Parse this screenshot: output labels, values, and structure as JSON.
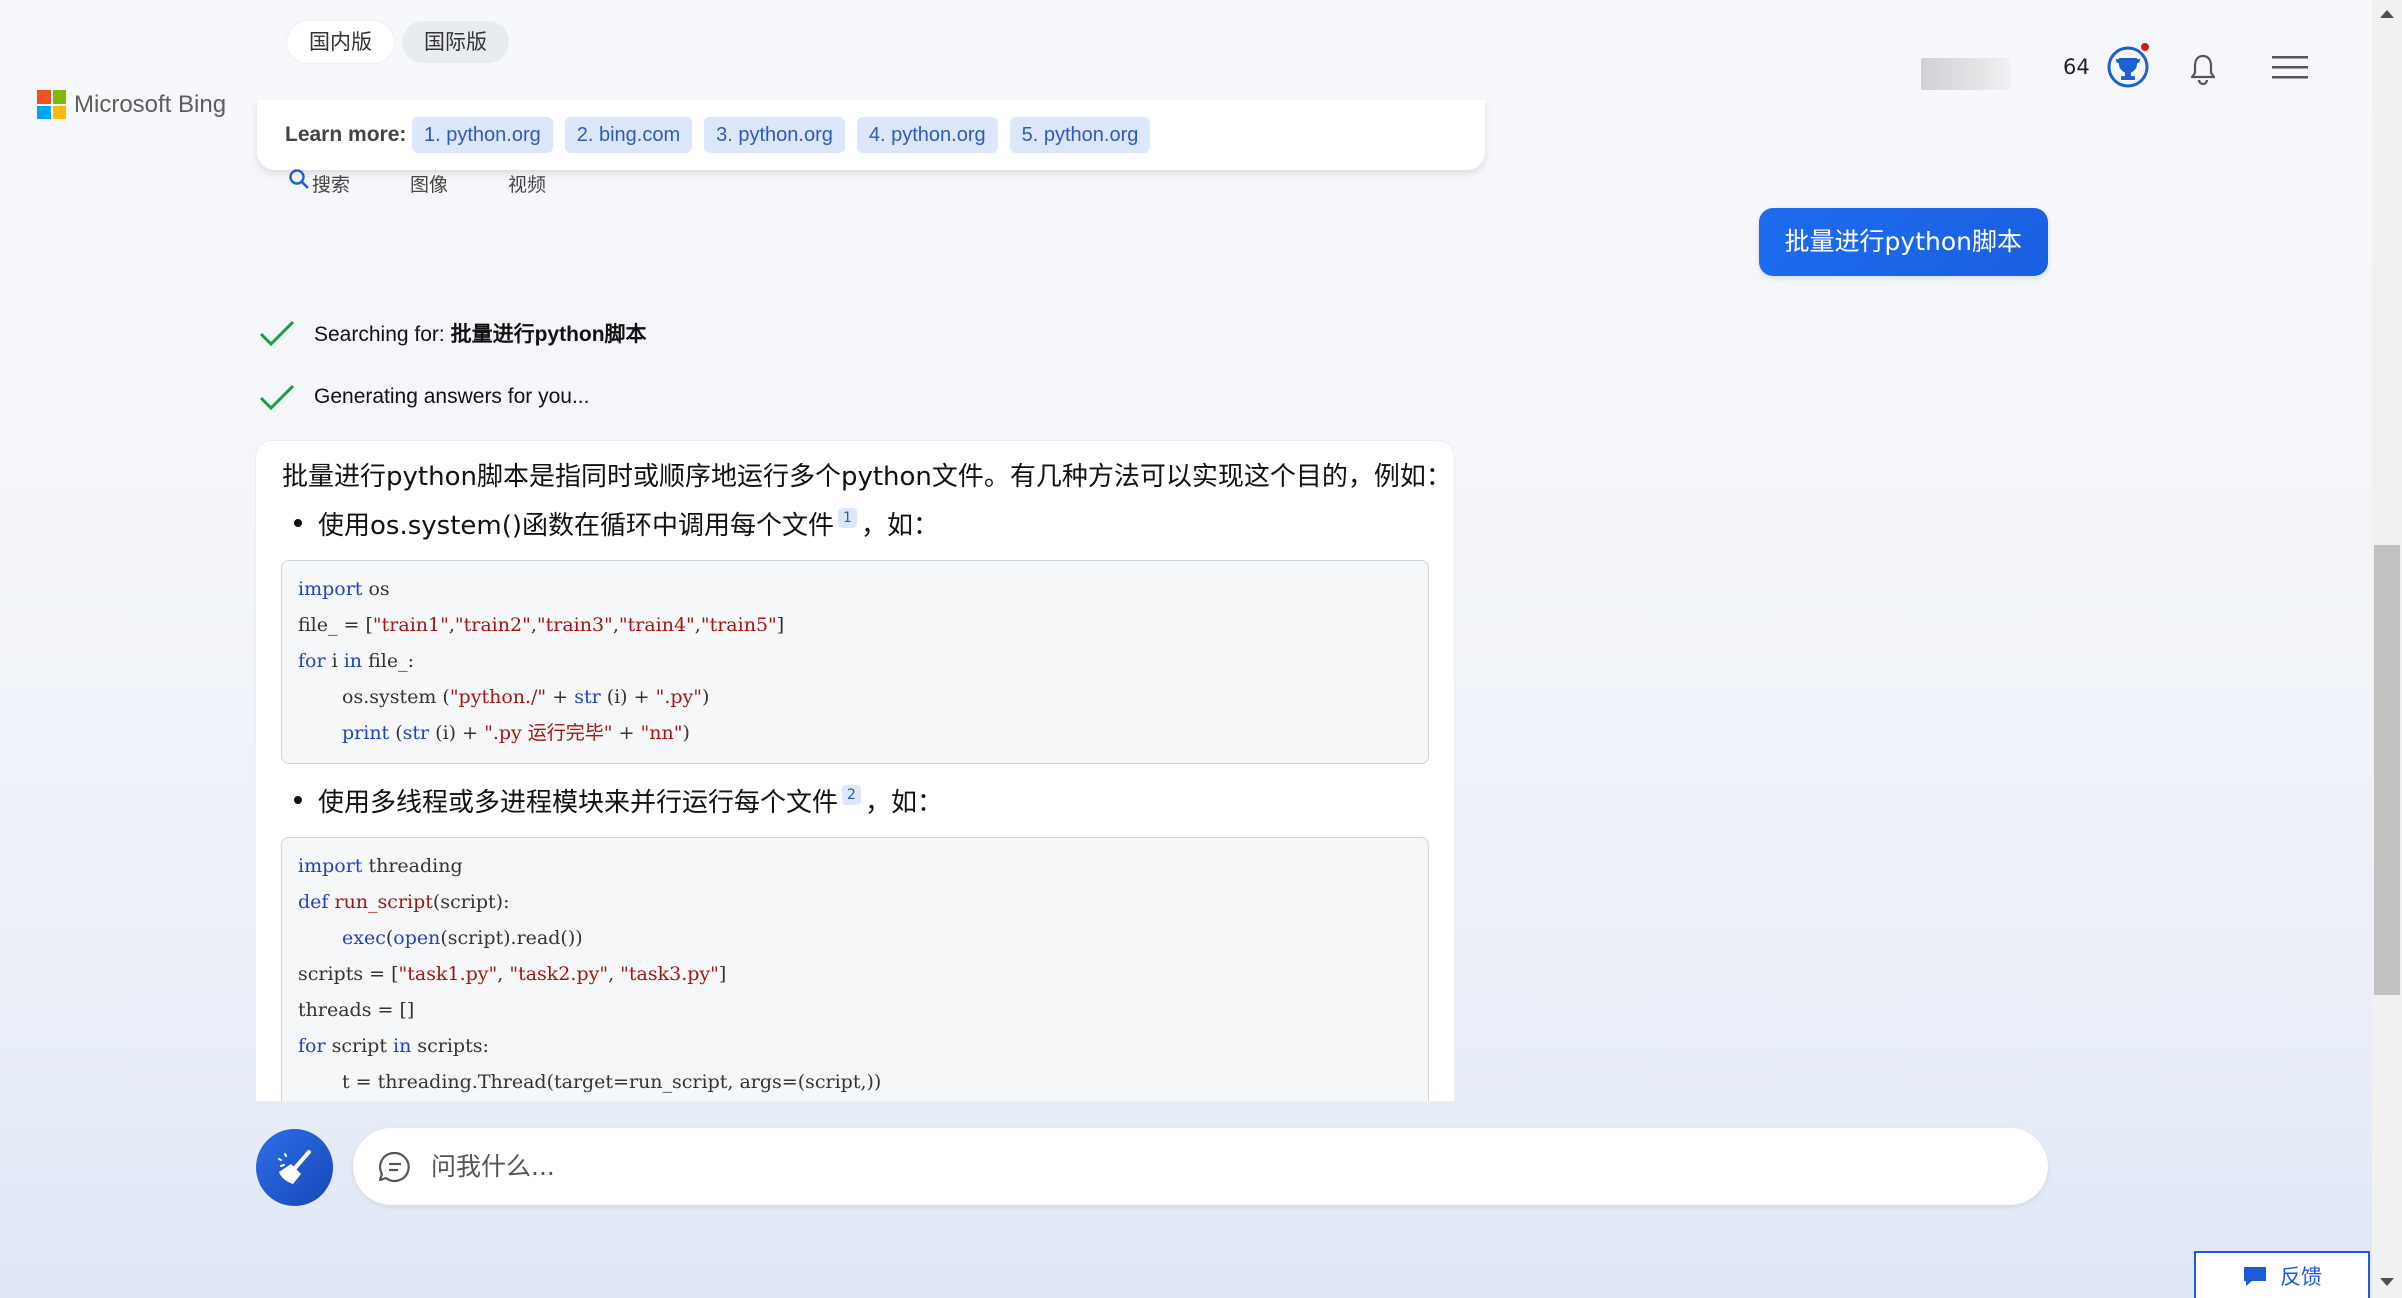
{
  "header": {
    "market_tabs": [
      "国内版",
      "国际版"
    ],
    "logo_text": "Microsoft Bing",
    "reward_points": "64"
  },
  "learn_more": {
    "label": "Learn more:",
    "links": [
      "1. python.org",
      "2. bing.com",
      "3. python.org",
      "4. python.org",
      "5. python.org"
    ]
  },
  "search_tabs": [
    "搜索",
    "图像",
    "视频"
  ],
  "user_message": "批量进行python脚本",
  "progress": {
    "searching_prefix": "Searching for: ",
    "searching_query": "批量进行python脚本",
    "generating": "Generating answers for you..."
  },
  "answer": {
    "intro": "批量进行python脚本是指同时或顺序地运行多个python文件。有几种方法可以实现这个目的，例如：",
    "bullets": [
      {
        "text": "使用os.system()函数在循环中调用每个文件",
        "cite": "1",
        "suffix": "，如："
      },
      {
        "text": "使用多线程或多进程模块来并行运行每个文件",
        "cite": "2",
        "suffix": "，如："
      }
    ],
    "code1": [
      "import os",
      "file_ = [\"train1\",\"train2\",\"train3\",\"train4\",\"train5\"]",
      "for i in file_:",
      "    os.system (\"python./\" + str (i) + \".py\")",
      "    print (str (i) + \".py 运行完毕\" + \"nn\")"
    ],
    "code2": [
      "import threading",
      "def run_script(script):",
      "    exec(open(script).read())",
      "scripts = [\"task1.py\", \"task2.py\", \"task3.py\"]",
      "threads = []",
      "for script in scripts:",
      "    t = threading.Thread(target=run_script, args=(script,))"
    ]
  },
  "input": {
    "placeholder": "问我什么..."
  },
  "feedback_label": "反馈",
  "colors": {
    "accent": "#1e5bd8",
    "user_bubble": "#1d6df0",
    "check": "#1a9b3c",
    "code_keyword": "#2140c4",
    "code_string": "#a31515"
  }
}
